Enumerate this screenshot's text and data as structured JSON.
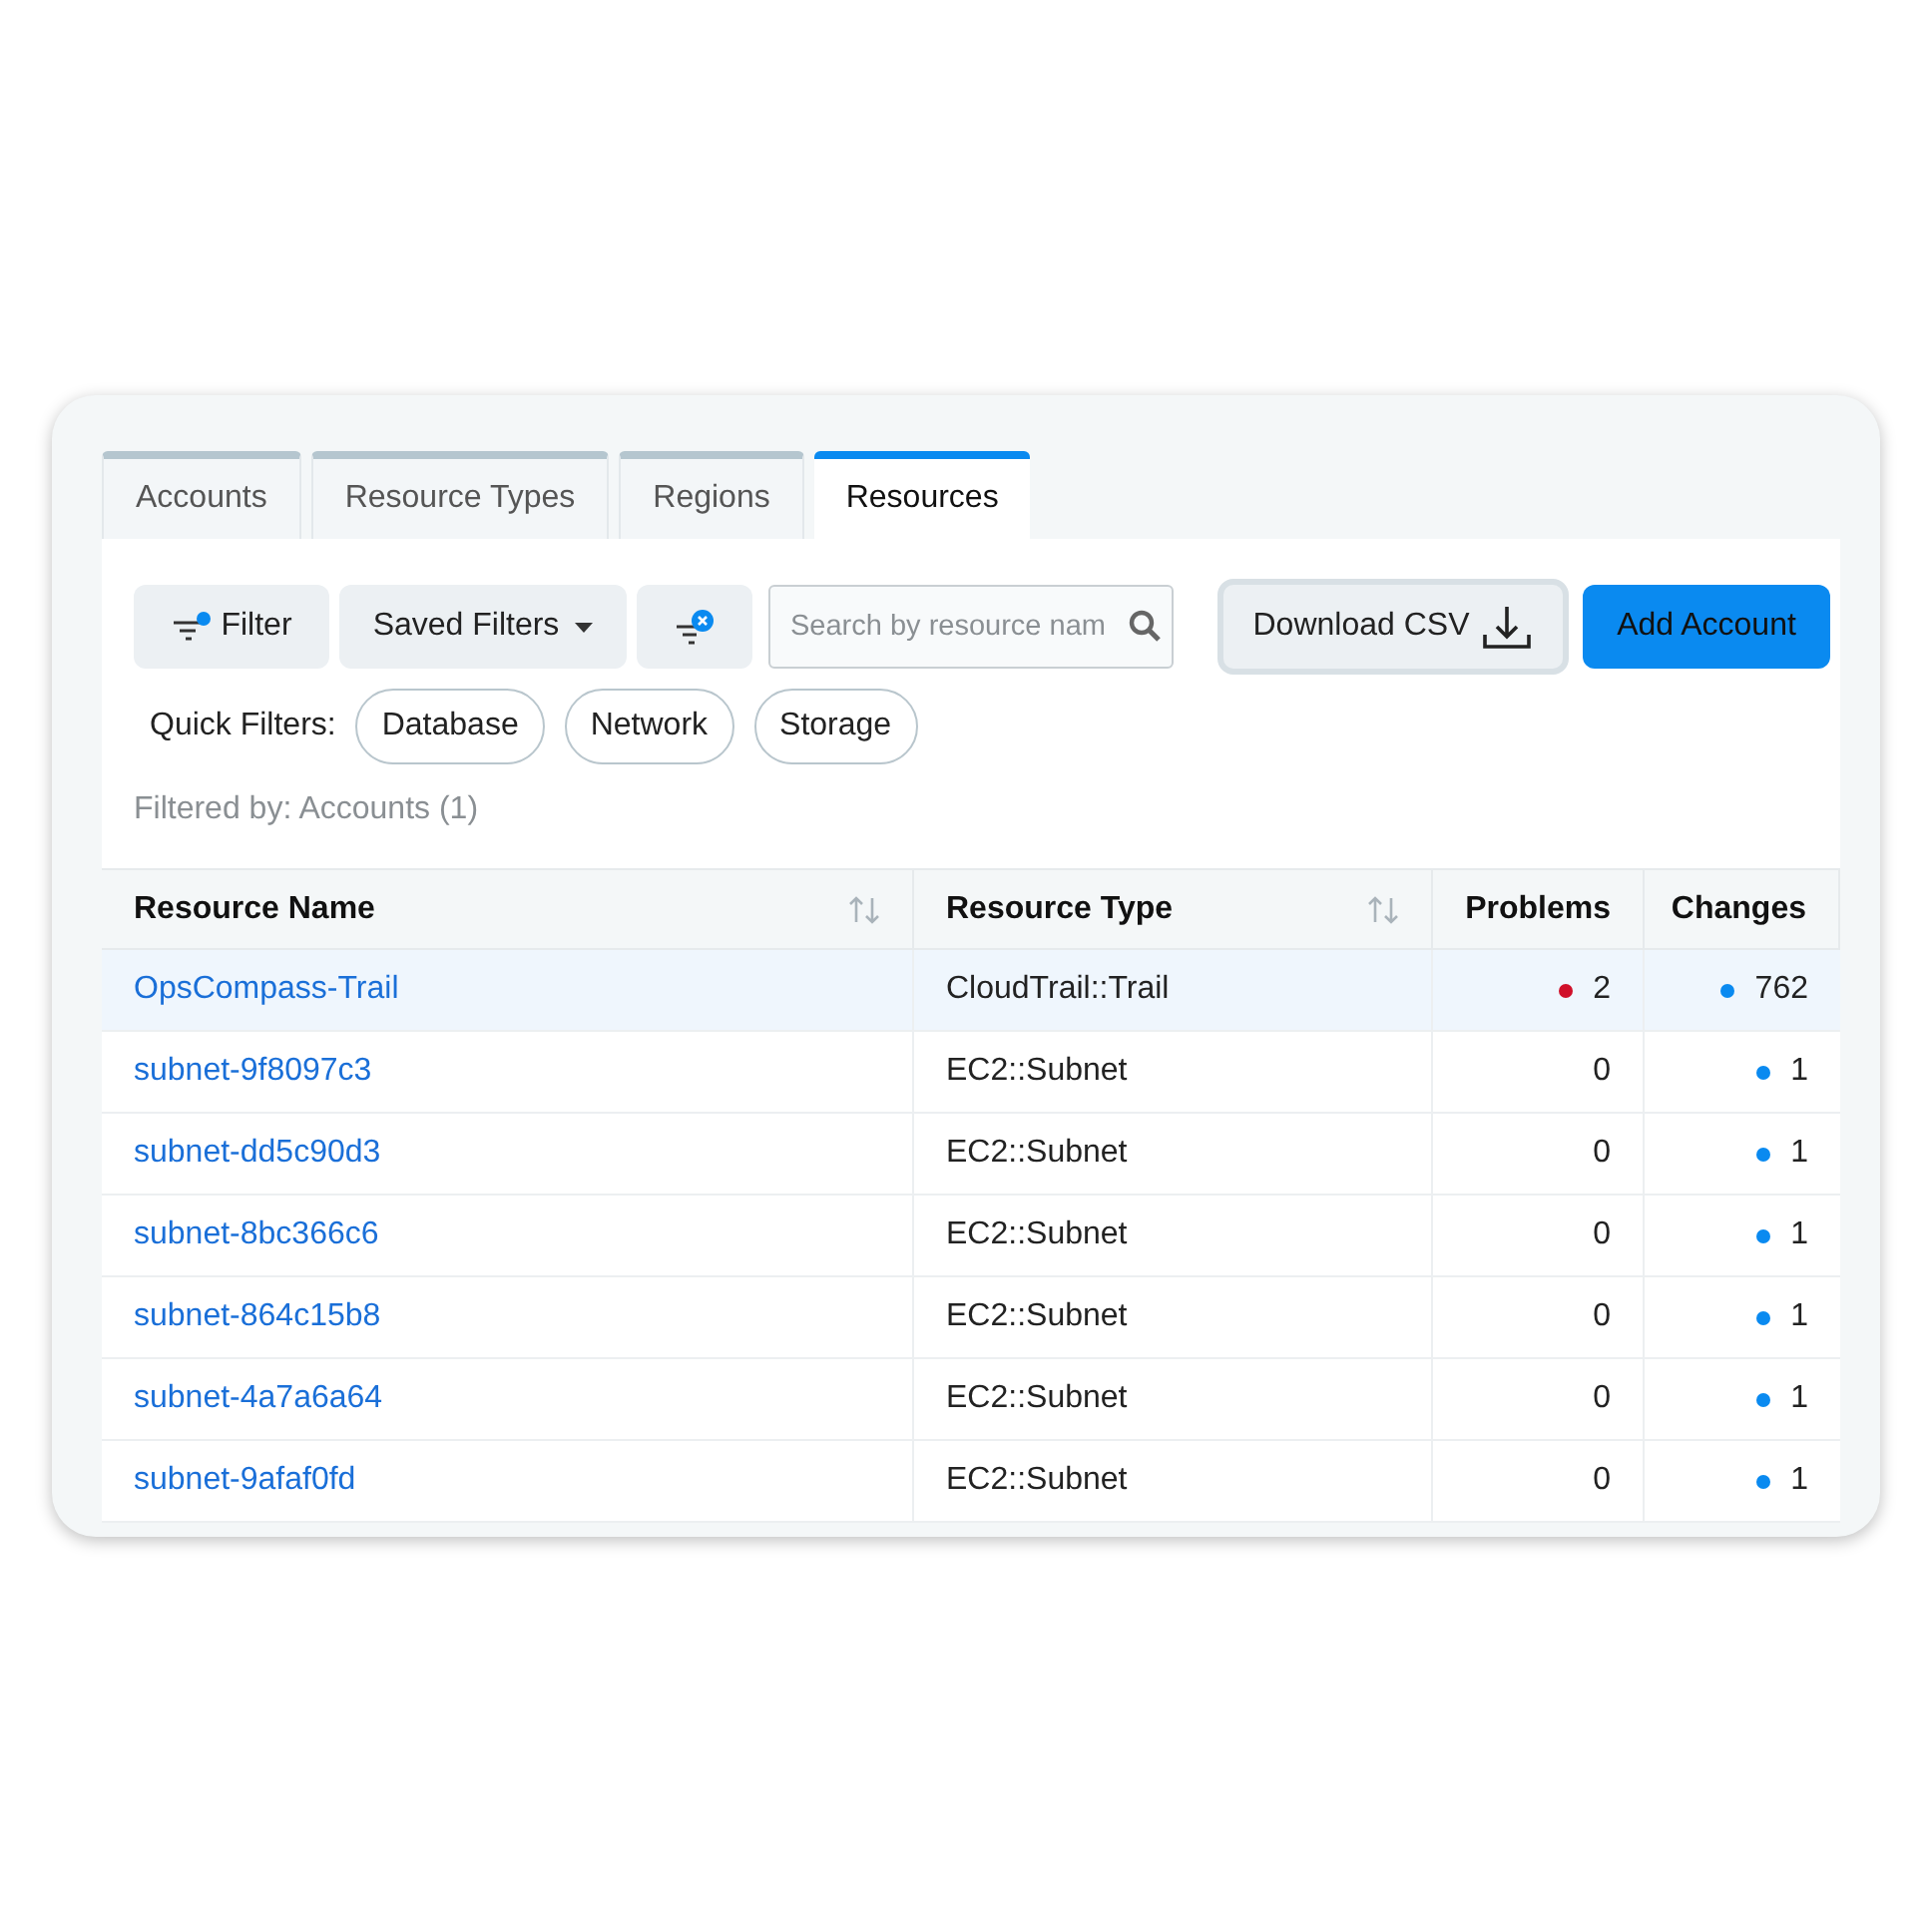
{
  "tabs": [
    {
      "label": "Accounts",
      "selected": false
    },
    {
      "label": "Resource Types",
      "selected": false
    },
    {
      "label": "Regions",
      "selected": false
    },
    {
      "label": "Resources",
      "selected": true
    }
  ],
  "toolbar": {
    "filter_button": "Filter",
    "saved_filters_button": "Saved Filters",
    "search": {
      "placeholder": "Search by resource nam"
    },
    "download_button": "Download CSV",
    "add_button": "Add Account"
  },
  "quick_filters": {
    "label": "Quick Filters:",
    "chips": [
      "Database",
      "Network",
      "Storage"
    ]
  },
  "filtered_by": "Filtered by: Accounts (1)",
  "table": {
    "columns": [
      {
        "label": "Resource Name",
        "sortable": true
      },
      {
        "label": "Resource Type",
        "sortable": true
      },
      {
        "label": "Problems",
        "sortable": false
      },
      {
        "label": "Changes",
        "sortable": false
      }
    ],
    "rows": [
      {
        "name": "OpsCompass-Trail",
        "type": "CloudTrail::Trail",
        "problems": "2",
        "problems_alert": true,
        "changes": "762",
        "changes_dot": true,
        "selected": true
      },
      {
        "name": "subnet-9f8097c3",
        "type": "EC2::Subnet",
        "problems": "0",
        "problems_alert": false,
        "changes": "1",
        "changes_dot": true,
        "selected": false
      },
      {
        "name": "subnet-dd5c90d3",
        "type": "EC2::Subnet",
        "problems": "0",
        "problems_alert": false,
        "changes": "1",
        "changes_dot": true,
        "selected": false
      },
      {
        "name": "subnet-8bc366c6",
        "type": "EC2::Subnet",
        "problems": "0",
        "problems_alert": false,
        "changes": "1",
        "changes_dot": true,
        "selected": false
      },
      {
        "name": "subnet-864c15b8",
        "type": "EC2::Subnet",
        "problems": "0",
        "problems_alert": false,
        "changes": "1",
        "changes_dot": true,
        "selected": false
      },
      {
        "name": "subnet-4a7a6a64",
        "type": "EC2::Subnet",
        "problems": "0",
        "problems_alert": false,
        "changes": "1",
        "changes_dot": true,
        "selected": false
      },
      {
        "name": "subnet-9afaf0fd",
        "type": "EC2::Subnet",
        "problems": "0",
        "problems_alert": false,
        "changes": "1",
        "changes_dot": true,
        "selected": false
      }
    ]
  }
}
